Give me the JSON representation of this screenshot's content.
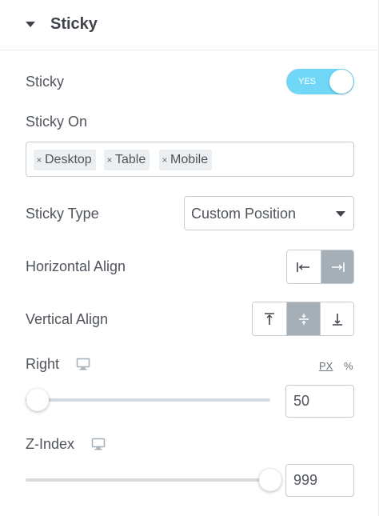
{
  "section": {
    "title": "Sticky"
  },
  "sticky": {
    "label": "Sticky",
    "toggle_text": "YES",
    "toggle_on": true
  },
  "sticky_on": {
    "label": "Sticky On",
    "tags": [
      "Desktop",
      "Table",
      "Mobile"
    ],
    "remove_glyph": "×"
  },
  "sticky_type": {
    "label": "Sticky Type",
    "value": "Custom Position"
  },
  "horizontal_align": {
    "label": "Horizontal Align",
    "options": [
      "align-left-icon",
      "align-right-icon"
    ],
    "active_index": 1
  },
  "vertical_align": {
    "label": "Vertical Align",
    "options": [
      "align-top-icon",
      "align-middle-icon",
      "align-bottom-icon"
    ],
    "active_index": 1
  },
  "right": {
    "label": "Right",
    "device_icon": "desktop-icon",
    "units": [
      "PX",
      "%"
    ],
    "active_unit": "PX",
    "value": "50"
  },
  "z_index": {
    "label": "Z-Index",
    "device_icon": "desktop-icon",
    "value": "999"
  },
  "colors": {
    "accent": "#71d7f7",
    "active_segment": "#a4afb7",
    "text": "#50555c"
  }
}
